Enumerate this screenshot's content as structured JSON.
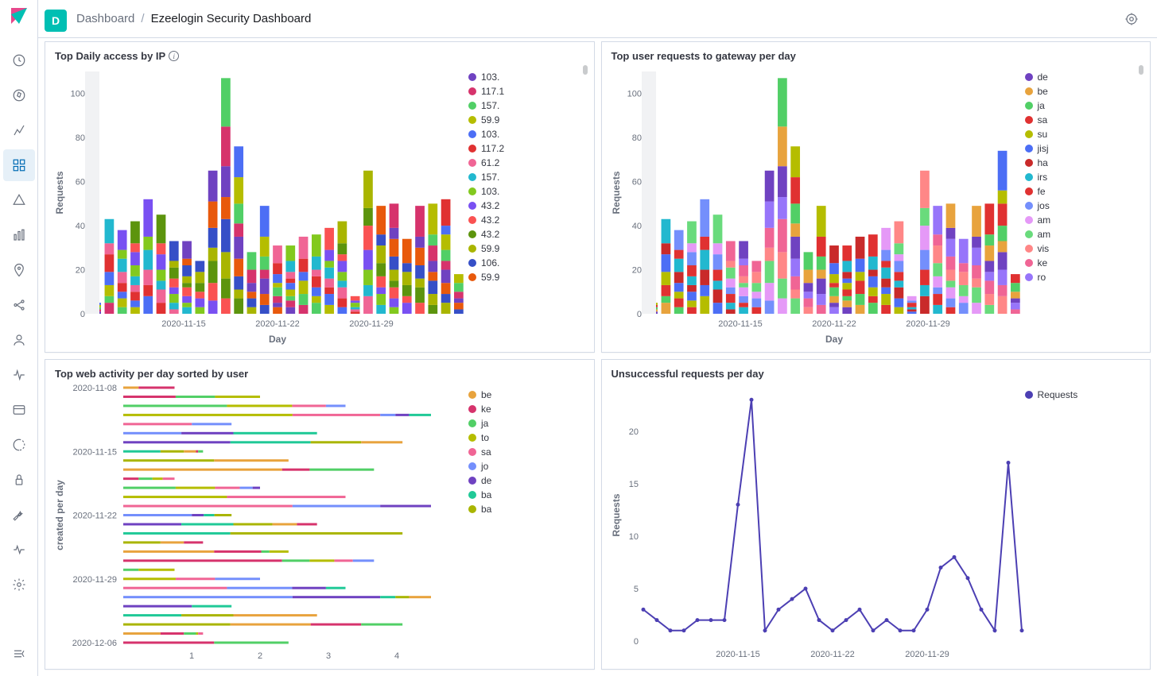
{
  "space_letter": "D",
  "breadcrumb": {
    "root": "Dashboard",
    "current": "Ezeelogin Security Dashboard"
  },
  "panels": {
    "p1": {
      "title": "Top Daily access by IP"
    },
    "p2": {
      "title": "Top user requests to gateway per day"
    },
    "p3": {
      "title": "Top web activity per day sorted by user"
    },
    "p4": {
      "title": "Unsuccessful requests per day"
    }
  },
  "chart_data": [
    {
      "id": "p1",
      "type": "bar",
      "stacked": true,
      "xlabel": "Day",
      "ylabel": "Requests",
      "ylim": [
        0,
        110
      ],
      "x_ticks": [
        "2020-11-15",
        "2020-11-22",
        "2020-11-29"
      ],
      "categories": [
        "2020-11-09",
        "2020-11-10",
        "2020-11-11",
        "2020-11-12",
        "2020-11-13",
        "2020-11-14",
        "2020-11-15",
        "2020-11-16",
        "2020-11-17",
        "2020-11-18",
        "2020-11-19",
        "2020-11-20",
        "2020-11-21",
        "2020-11-22",
        "2020-11-23",
        "2020-11-24",
        "2020-11-25",
        "2020-11-26",
        "2020-11-27",
        "2020-11-28",
        "2020-11-29",
        "2020-11-30",
        "2020-12-01",
        "2020-12-02",
        "2020-12-03",
        "2020-12-04",
        "2020-12-05",
        "2020-12-06"
      ],
      "totals": [
        5,
        43,
        38,
        42,
        52,
        45,
        33,
        33,
        24,
        65,
        107,
        76,
        28,
        49,
        31,
        31,
        35,
        36,
        39,
        42,
        8,
        65,
        49,
        50,
        34,
        49,
        50,
        52,
        18
      ],
      "legend": [
        {
          "label": "103.",
          "color": "#6f42c1"
        },
        {
          "label": "117.1",
          "color": "#d6336c"
        },
        {
          "label": "157.",
          "color": "#51cf66"
        },
        {
          "label": "59.9",
          "color": "#b5bd00"
        },
        {
          "label": "103.",
          "color": "#4c6ef5"
        },
        {
          "label": "117.2",
          "color": "#e03131"
        },
        {
          "label": "61.2",
          "color": "#f06595"
        },
        {
          "label": "157.",
          "color": "#22b8cf"
        },
        {
          "label": "103.",
          "color": "#82c91e"
        },
        {
          "label": "43.2",
          "color": "#7950f2"
        },
        {
          "label": "43.2",
          "color": "#fa5252"
        },
        {
          "label": "43.2",
          "color": "#5c940d"
        },
        {
          "label": "59.9",
          "color": "#a9b500"
        },
        {
          "label": "106.",
          "color": "#364fc7"
        },
        {
          "label": "59.9",
          "color": "#e8590c"
        }
      ]
    },
    {
      "id": "p2",
      "type": "bar",
      "stacked": true,
      "xlabel": "Day",
      "ylabel": "Requests",
      "ylim": [
        0,
        110
      ],
      "x_ticks": [
        "2020-11-15",
        "2020-11-22",
        "2020-11-29"
      ],
      "categories": [
        "2020-11-09",
        "2020-11-10",
        "2020-11-11",
        "2020-11-12",
        "2020-11-13",
        "2020-11-14",
        "2020-11-15",
        "2020-11-16",
        "2020-11-17",
        "2020-11-18",
        "2020-11-19",
        "2020-11-20",
        "2020-11-21",
        "2020-11-22",
        "2020-11-23",
        "2020-11-24",
        "2020-11-25",
        "2020-11-26",
        "2020-11-27",
        "2020-11-28",
        "2020-11-29",
        "2020-11-30",
        "2020-12-01",
        "2020-12-02",
        "2020-12-03",
        "2020-12-04",
        "2020-12-05",
        "2020-12-06"
      ],
      "totals": [
        5,
        43,
        38,
        42,
        52,
        45,
        33,
        33,
        24,
        65,
        107,
        76,
        28,
        49,
        31,
        31,
        35,
        36,
        39,
        42,
        8,
        65,
        49,
        50,
        34,
        49,
        50,
        74,
        18
      ],
      "legend": [
        {
          "label": "de",
          "color": "#6f42c1"
        },
        {
          "label": "be",
          "color": "#e8a33d"
        },
        {
          "label": "ja",
          "color": "#51cf66"
        },
        {
          "label": "sa",
          "color": "#e03131"
        },
        {
          "label": "su",
          "color": "#b5bd00"
        },
        {
          "label": "jisj",
          "color": "#4c6ef5"
        },
        {
          "label": "ha",
          "color": "#c92a2a"
        },
        {
          "label": "irs",
          "color": "#22b8cf"
        },
        {
          "label": "fe",
          "color": "#e03131"
        },
        {
          "label": "jos",
          "color": "#748ffc"
        },
        {
          "label": "am",
          "color": "#e599f7"
        },
        {
          "label": "am",
          "color": "#69db7c"
        },
        {
          "label": "vis",
          "color": "#ff8787"
        },
        {
          "label": "ke",
          "color": "#f06595"
        },
        {
          "label": "ro",
          "color": "#9775fa"
        }
      ]
    },
    {
      "id": "p3",
      "type": "bar",
      "orientation": "horizontal",
      "stacked": true,
      "xlabel": "",
      "ylabel": "created per day",
      "y_ticks": [
        "2020-11-08",
        "2020-11-15",
        "2020-11-22",
        "2020-11-29",
        "2020-12-06"
      ],
      "x_ticks": [
        "1",
        "2",
        "3",
        "4"
      ],
      "categories": [
        "2020-11-08",
        "2020-11-09",
        "2020-11-10",
        "2020-11-11",
        "2020-11-12",
        "2020-11-13",
        "2020-11-14",
        "2020-11-15",
        "2020-11-16",
        "2020-11-17",
        "2020-11-18",
        "2020-11-19",
        "2020-11-20",
        "2020-11-21",
        "2020-11-22",
        "2020-11-23",
        "2020-11-24",
        "2020-11-25",
        "2020-11-26",
        "2020-11-27",
        "2020-11-28",
        "2020-11-29",
        "2020-11-30",
        "2020-12-01",
        "2020-12-02",
        "2020-12-03",
        "2020-12-04",
        "2020-12-05",
        "2020-12-06"
      ],
      "legend": [
        {
          "label": "be",
          "color": "#e8a33d"
        },
        {
          "label": "ke",
          "color": "#d6336c"
        },
        {
          "label": "ja",
          "color": "#51cf66"
        },
        {
          "label": "to",
          "color": "#b5bd00"
        },
        {
          "label": "sa",
          "color": "#f06595"
        },
        {
          "label": "jo",
          "color": "#748ffc"
        },
        {
          "label": "de",
          "color": "#6f42c1"
        },
        {
          "label": "ba",
          "color": "#20c997"
        },
        {
          "label": "ba",
          "color": "#a9b500"
        }
      ]
    },
    {
      "id": "p4",
      "type": "line",
      "xlabel": "",
      "ylabel": "Requests",
      "ylim": [
        0,
        24
      ],
      "x_ticks": [
        "2020-11-15",
        "2020-11-22",
        "2020-11-29"
      ],
      "series": [
        {
          "name": "Requests",
          "color": "#4c3fb3",
          "x": [
            "2020-11-09",
            "2020-11-10",
            "2020-11-11",
            "2020-11-12",
            "2020-11-13",
            "2020-11-14",
            "2020-11-15",
            "2020-11-16",
            "2020-11-17",
            "2020-11-18",
            "2020-11-19",
            "2020-11-20",
            "2020-11-21",
            "2020-11-22",
            "2020-11-23",
            "2020-11-24",
            "2020-11-25",
            "2020-11-26",
            "2020-11-27",
            "2020-11-28",
            "2020-11-29",
            "2020-11-30",
            "2020-12-01",
            "2020-12-02",
            "2020-12-03",
            "2020-12-04",
            "2020-12-05",
            "2020-12-06"
          ],
          "y": [
            3,
            2,
            1,
            1,
            2,
            2,
            2,
            13,
            23,
            1,
            3,
            4,
            5,
            2,
            1,
            2,
            3,
            1,
            2,
            1,
            1,
            3,
            7,
            8,
            6,
            3,
            1,
            17,
            1
          ]
        }
      ],
      "legend": [
        {
          "label": "Requests",
          "color": "#4c3fb3"
        }
      ]
    }
  ]
}
